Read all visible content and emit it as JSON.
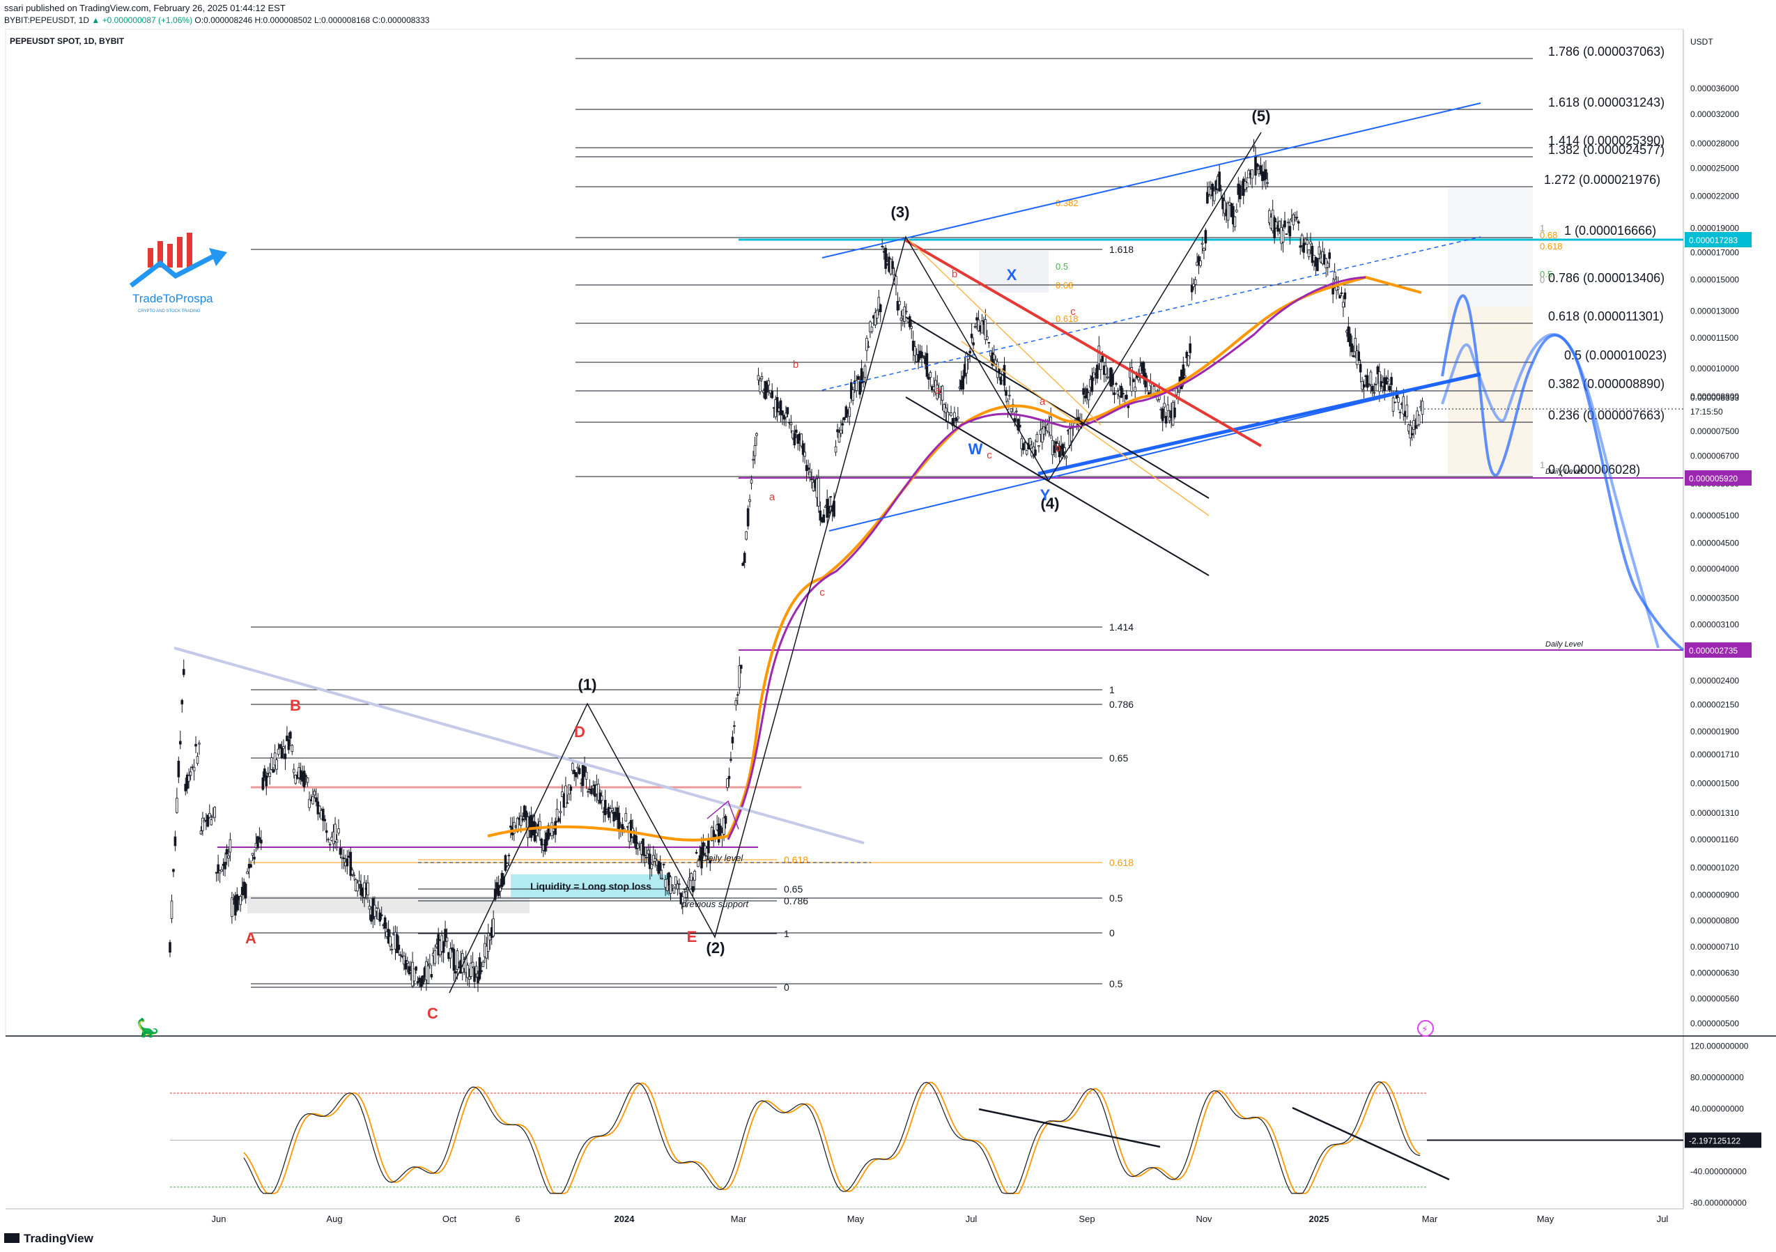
{
  "header": {
    "publisher": "ssari published on TradingView.com, February 26, 2025 01:44:12 EST",
    "ticker": "BYBIT:PEPEUSDT, 1D",
    "change": "+0.000000087 (+1.06%)",
    "o": "O:0.000008246",
    "h": "H:0.000008502",
    "l": "L:0.000008168",
    "c": "C:0.000008333",
    "symbol_line": "PEPEUSDT SPOT, 1D, BYBIT"
  },
  "logo": {
    "name": "TradeToProspa",
    "tag": "CRYPTO AND STOCK TRADING"
  },
  "footer": {
    "brand": "TradingView"
  },
  "chart_data": {
    "type": "candlestick",
    "price_scale": "log",
    "currency": "USDT",
    "y_ticks": [
      "0.000036000",
      "0.000032000",
      "0.000028000",
      "0.000025000",
      "0.000022000",
      "0.000019000",
      "0.000017000",
      "0.000015000",
      "0.000013000",
      "0.000011500",
      "0.000010000",
      "0.000008800",
      "0.000007500",
      "0.000006700",
      "0.000005900",
      "0.000005100",
      "0.000004500",
      "0.000004000",
      "0.000003500",
      "0.000003100",
      "0.000002750",
      "0.000002400",
      "0.000002150",
      "0.000001900",
      "0.000001710",
      "0.000001500",
      "0.000001310",
      "0.000001160",
      "0.000001020",
      "0.000000900",
      "0.000000800",
      "0.000000710",
      "0.000000630",
      "0.000000560",
      "0.000000500"
    ],
    "x_ticks": [
      "Jun",
      "Aug",
      "Oct",
      "6",
      "2024",
      "Mar",
      "May",
      "Jul",
      "Sep",
      "Nov",
      "2025",
      "Mar",
      "May",
      "Jul"
    ],
    "last_price": {
      "label": "0.000008333",
      "time": "17:15:50"
    },
    "price_badges": [
      {
        "value": "0.000017283",
        "color": "#00bcd4"
      },
      {
        "value": "0.000005920",
        "color": "#9c27b0"
      },
      {
        "value": "0.000002735",
        "color": "#9c27b0"
      }
    ],
    "fib_extension_labels": [
      "1.786 (0.000037063)",
      "1.618 (0.000031243)",
      "1.414 (0.000025390)",
      "1.382 (0.000024577)",
      "1.272 (0.000021976)",
      "1 (0.000016666)",
      "0.786 (0.000013406)",
      "0.618 (0.000011301)",
      "0.5 (0.000010023)",
      "0.382 (0.000008890)",
      "0.236 (0.000007663)",
      "0 (0.000006028)"
    ],
    "fib_retracement_labels": [
      "1.618",
      "1.414",
      "1",
      "0.786",
      "0.65",
      "0.618",
      "0.5",
      "0",
      "0.5",
      "0.618",
      "0.65",
      "0.786",
      "1",
      "0"
    ],
    "fib_small_labels": [
      "0.68",
      "0.618",
      "0.5",
      "0.68",
      "0.618",
      "0.5",
      "0.382",
      "1",
      "1",
      "0"
    ],
    "wave_labels": [
      "(1)",
      "(2)",
      "(3)",
      "(4)",
      "(5)"
    ],
    "corrective_labels": [
      "A",
      "B",
      "C",
      "D",
      "E"
    ],
    "wxy_labels": [
      "W",
      "X",
      "Y"
    ],
    "small_abc_labels": [
      "a",
      "b",
      "c",
      "a",
      "b",
      "c",
      "a",
      "b",
      "c"
    ],
    "annotations": [
      "Liquidity = Long stop loss",
      "Daily level",
      "previous support",
      "Daily Level",
      "Daily Level"
    ],
    "series": [
      {
        "name": "",
        "values": []
      },
      {
        "name": "",
        "values": []
      }
    ],
    "oscillator": {
      "y_ticks": [
        "120.000000000",
        "80.000000000",
        "40.000000000",
        "-40.000000000",
        "-80.000000000"
      ],
      "current_value": "-2.197125122",
      "ylim": [
        -85,
        125
      ]
    },
    "ohlc_path": [
      [
        7.2e-07,
        3e-06
      ],
      [
        1.5e-06,
        1.8e-06
      ],
      [
        1.2e-06,
        1.35e-06
      ],
      [
        1e-06,
        1.1e-06
      ],
      [
        8.5e-07,
        9.5e-07
      ],
      [
        1e-06,
        1.2e-06
      ],
      [
        1.5e-06,
        1.7e-06
      ],
      [
        1.75e-06,
        1.85e-06
      ],
      [
        1.6e-06,
        1.5e-06
      ],
      [
        1.4e-06,
        1.3e-06
      ],
      [
        1.25e-06,
        1.15e-06
      ],
      [
        1.1e-06,
        1e-06
      ],
      [
        9.5e-07,
        9e-07
      ],
      [
        8.5e-07,
        8e-07
      ],
      [
        7.5e-07,
        7e-07
      ],
      [
        6.6e-07,
        6.2e-07
      ],
      [
        6e-07,
        6.5e-07
      ],
      [
        7e-07,
        7.5e-07
      ],
      [
        6.8e-07,
        6.5e-07
      ],
      [
        6.4e-07,
        6.2e-07
      ],
      [
        6.5e-07,
        8e-07
      ],
      [
        9e-07,
        1.1e-06
      ],
      [
        1.2e-06,
        1.3e-06
      ],
      [
        1.25e-06,
        1.2e-06
      ],
      [
        1.15e-06,
        1.25e-06
      ],
      [
        1.3e-06,
        1.5e-06
      ],
      [
        1.6e-06,
        1.55e-06
      ],
      [
        1.5e-06,
        1.4e-06
      ],
      [
        1.35e-06,
        1.3e-06
      ],
      [
        1.25e-06,
        1.2e-06
      ],
      [
        1.15e-06,
        1.1e-06
      ],
      [
        1.05e-06,
        1e-06
      ],
      [
        9.5e-07,
        9.2e-07
      ],
      [
        9e-07,
        9.8e-07
      ],
      [
        1.05e-06,
        1.12e-06
      ],
      [
        1.18e-06,
        1.22e-06
      ],
      [
        1.5e-06,
        2.8e-06
      ],
      [
        4e-06,
        8e-06
      ],
      [
        9.5e-06,
        9e-06
      ],
      [
        8.5e-06,
        8.2e-06
      ],
      [
        7.6e-06,
        7e-06
      ],
      [
        6.5e-06,
        5.6e-06
      ],
      [
        5e-06,
        5.5e-06
      ],
      [
        7e-06,
        8.5e-06
      ],
      [
        9e-06,
        9.8e-06
      ],
      [
        1.1e-05,
        1.4e-05
      ],
      [
        1.7e-05,
        1.5e-05
      ],
      [
        1.35e-05,
        1.2e-05
      ],
      [
        1.1e-05,
        1e-05
      ],
      [
        9.5e-06,
        8.8e-06
      ],
      [
        8.2e-06,
        7.8e-06
      ],
      [
        9e-06,
        1.2e-05
      ],
      [
        1.25e-05,
        1.15e-05
      ],
      [
        1.05e-05,
        9.5e-06
      ],
      [
        8.8e-06,
        7.5e-06
      ],
      [
        7e-06,
        6.8e-06
      ],
      [
        7.2e-06,
        7.8e-06
      ],
      [
        7e-06,
        6.8e-06
      ],
      [
        7.2e-06,
        8e-06
      ],
      [
        8.8e-06,
        1e-05
      ],
      [
        1.05e-05,
        9.5e-06
      ],
      [
        9e-06,
        8.8e-06
      ],
      [
        9.5e-06,
        1e-05
      ],
      [
        9.5e-06,
        8.5e-06
      ],
      [
        8e-06,
        8.2e-06
      ],
      [
        9e-06,
        1.1e-05
      ],
      [
        1.4e-05,
        1.9e-05
      ],
      [
        2.2e-05,
        2.4e-05
      ],
      [
        2.1e-05,
        2e-05
      ],
      [
        2.2e-05,
        2.5e-05
      ],
      [
        2.6e-05,
        2.3e-05
      ],
      [
        2e-05,
        1.8e-05
      ],
      [
        1.9e-05,
        2e-05
      ],
      [
        1.8e-05,
        1.7e-05
      ],
      [
        1.65e-05,
        1.6e-05
      ],
      [
        1.5e-05,
        1.35e-05
      ],
      [
        1.2e-05,
        1e-05
      ],
      [
        9.5e-06,
        9e-06
      ],
      [
        9.5e-06,
        9.2e-06
      ],
      [
        8.8e-06,
        8e-06
      ],
      [
        7.5e-06,
        8.33e-06
      ]
    ]
  }
}
